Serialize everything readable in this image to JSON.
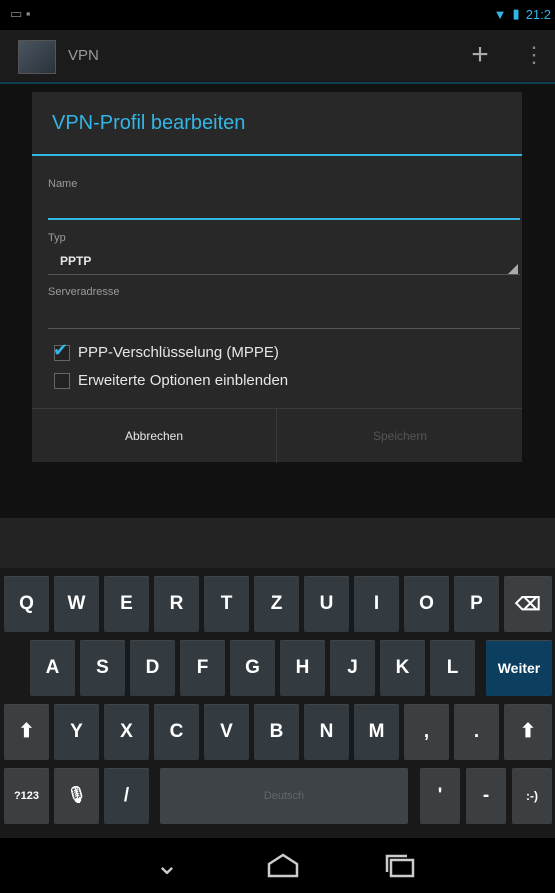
{
  "statusbar": {
    "time": "21:2"
  },
  "actionbar": {
    "title": "VPN",
    "add_icon": "+",
    "menu_icon": "⋮"
  },
  "dialog": {
    "title": "VPN-Profil bearbeiten",
    "name_label": "Name",
    "name_value": "",
    "type_label": "Typ",
    "type_value": "PPTP",
    "server_label": "Serveradresse",
    "server_value": "",
    "mppe_label": "PPP-Verschlüsselung (MPPE)",
    "mppe_checked": true,
    "advanced_label": "Erweiterte Optionen einblenden",
    "advanced_checked": false,
    "cancel_label": "Abbrechen",
    "save_label": "Speichern"
  },
  "keyboard": {
    "row1": [
      "Q",
      "W",
      "E",
      "R",
      "T",
      "Z",
      "U",
      "I",
      "O",
      "P"
    ],
    "row2": [
      "A",
      "S",
      "D",
      "F",
      "G",
      "H",
      "J",
      "K",
      "L"
    ],
    "row3": [
      "Y",
      "X",
      "C",
      "V",
      "B",
      "N",
      "M",
      ",",
      "."
    ],
    "go_label": "Weiter",
    "symbols_label": "?123",
    "slash_label": "/",
    "space_label": "Deutsch",
    "apostrophe_label": "'",
    "dash_label": "-",
    "smiley_label": ":-)",
    "backspace_icon": "⌫",
    "shift_icon": "⬆",
    "mic_icon": "🎙"
  },
  "navbar": {
    "back_icon": "⌄"
  }
}
